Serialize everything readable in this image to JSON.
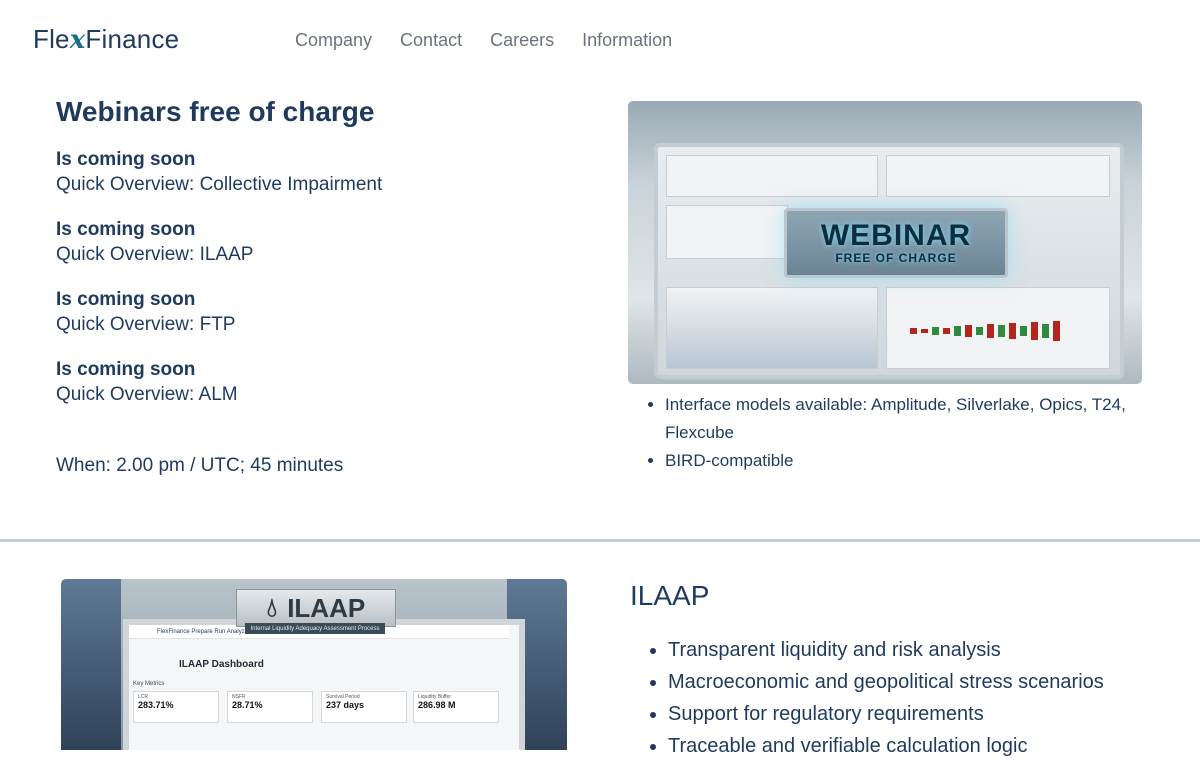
{
  "header": {
    "logo_prefix": "Fle",
    "logo_x": "x",
    "logo_suffix": "Finance",
    "nav": [
      "Company",
      "Contact",
      "Careers",
      "Information"
    ]
  },
  "webinars": {
    "heading": "Webinars free of charge",
    "items": [
      {
        "status": "Is coming soon",
        "title": "Quick Overview: Collective Impairment"
      },
      {
        "status": "Is coming soon",
        "title": "Quick Overview: ILAAP"
      },
      {
        "status": "Is coming soon",
        "title": "Quick Overview: FTP"
      },
      {
        "status": "Is coming soon",
        "title": "Quick Overview: ALM"
      }
    ],
    "when": "When: 2.00 pm / UTC; 45 minutes",
    "image": {
      "badge_big": "WEBINAR",
      "badge_small": "FREE OF CHARGE"
    },
    "features": [
      "Interface models available: Amplitude, Silverlake, Opics, T24, Flexcube",
      "BIRD-compatible"
    ]
  },
  "ilaap": {
    "heading": "ILAAP",
    "image": {
      "sign": "ILAAP",
      "sign_sub": "Internal Liquidity Adequacy Assessment Process",
      "topbar": "FlexFinance   Prepare   Run   Analyze   Admin",
      "dashboard_title": "ILAAP Dashboard",
      "key_metrics": "Key Metrics",
      "cards": [
        {
          "label": "LCR",
          "value": "283.71%"
        },
        {
          "label": "NSFR",
          "value": "28.71%"
        },
        {
          "label": "Survival Period",
          "value": "237 days"
        },
        {
          "label": "Liquidity Buffer",
          "value": "286.98 M"
        }
      ]
    },
    "features": [
      "Transparent liquidity and risk analysis",
      "Macroeconomic and geopolitical stress scenarios",
      "Support for regulatory requirements",
      "Traceable and verifiable calculation logic"
    ]
  },
  "colors": {
    "text": "#1f3a5f",
    "nav": "#6b7280",
    "divider": "#c6ced4"
  }
}
